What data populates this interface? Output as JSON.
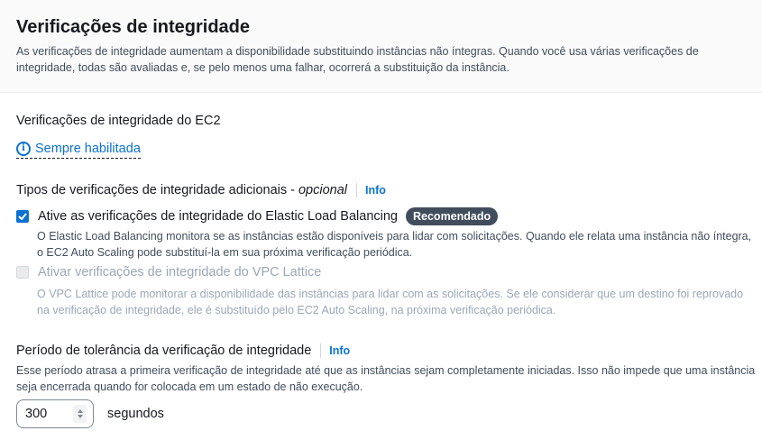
{
  "header": {
    "title": "Verificações de integridade",
    "description": "As verificações de integridade aumentam a disponibilidade substituindo instâncias não íntegras. Quando você usa várias verificações de integridade, todas são avaliadas e, se pelo menos uma falhar, ocorrerá a substituição da instância."
  },
  "ec2": {
    "label": "Verificações de integridade do EC2",
    "status": "Sempre habilitada",
    "status_icon": "info-icon"
  },
  "additional": {
    "label": "Tipos de verificações de integridade adicionais -",
    "optional": "opcional",
    "info": "Info",
    "options": [
      {
        "label": "Ative as verificações de integridade do Elastic Load Balancing",
        "badge": "Recomendado",
        "checked": true,
        "disabled": false,
        "description": "O Elastic Load Balancing monitora se as instâncias estão disponíveis para lidar com solicitações. Quando ele relata uma instância não íntegra, o EC2 Auto Scaling pode substituí-la em sua próxima verificação periódica."
      },
      {
        "label": "Ativar verificações de integridade do VPC Lattice",
        "checked": false,
        "disabled": true,
        "description": "O VPC Lattice pode monitorar a disponibilidade das instâncias para lidar com as solicitações. Se ele considerar que um destino foi reprovado na verificação de integridade, ele é substituído pelo EC2 Auto Scaling, na próxima verificação periódica."
      }
    ]
  },
  "grace": {
    "label": "Período de tolerância da verificação de integridade",
    "info": "Info",
    "description": "Esse período atrasa a primeira verificação de integridade até que as instâncias sejam completamente iniciadas. Isso não impede que uma instância seja encerrada quando for colocada em um estado de não execução.",
    "value": "300",
    "unit": "segundos"
  },
  "colors": {
    "link": "#0972d3",
    "badge_bg": "#414d5c",
    "text": "#16191f",
    "muted": "#414d5c",
    "disabled": "#9ba7b6"
  }
}
